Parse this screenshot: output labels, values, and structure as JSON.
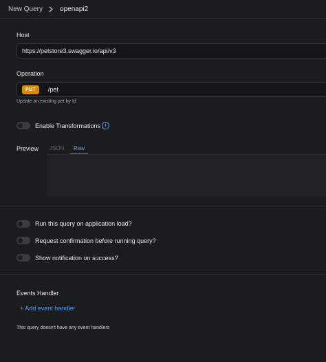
{
  "breadcrumb": {
    "root": "New Query",
    "current": "openapi2"
  },
  "host": {
    "label": "Host",
    "value": "https://petstore3.swagger.io/api/v3"
  },
  "operation": {
    "label": "Operation",
    "method": "PUT",
    "path": "/pet",
    "description": "Update an existing pet by Id",
    "method_color": "#d38c0f"
  },
  "transformations": {
    "label": "Enable Transformations",
    "enabled": false
  },
  "preview": {
    "label": "Preview",
    "tabs": [
      "JSON",
      "Raw"
    ],
    "active_tab": "Raw"
  },
  "options": [
    {
      "label": "Run this query on application load?",
      "enabled": false
    },
    {
      "label": "Request confirmation before running query?",
      "enabled": false
    },
    {
      "label": "Show notification on success?",
      "enabled": false
    }
  ],
  "events": {
    "title": "Events Handler",
    "add_label": "+ Add event handler",
    "empty_text": "This query doesn't have any event handlers"
  },
  "accent_color": "#4b8ef3"
}
